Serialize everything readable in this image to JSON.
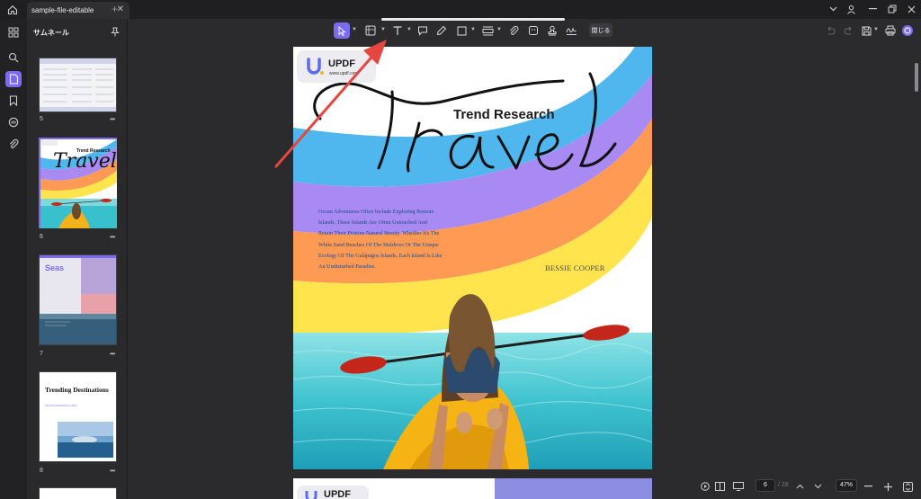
{
  "tab": {
    "title": "sample-file-editable",
    "close": "✕",
    "new": "+"
  },
  "sidebar": {
    "title": "サムネール",
    "thumbnails": [
      {
        "number": "5"
      },
      {
        "number": "6"
      },
      {
        "number": "7"
      },
      {
        "number": "8"
      }
    ],
    "more": "•••"
  },
  "thumb_texts": {
    "p6_title": "Travel",
    "p6_sub": "Trend Research",
    "p7_title": "Seas",
    "p8_title": "Trending Destinations",
    "p8_sub": "Top Travel Destinations of 2024"
  },
  "toolbar": {
    "close_label": "閉じる"
  },
  "page": {
    "logo": "UPDF",
    "logo_url": "www.updf.com",
    "title": "Travel",
    "subtitle": "Trend Research",
    "body_lines": [
      "Ocean Adventures Often Include Exploring Remote",
      "Islands. These Islands Are Often Untouched And",
      "Retain Their Pristine Natural Beauty. Whether It's The",
      "White Sand Beaches Of The Maldives Or The Unique",
      "Ecology Of The Galápagos Islands, Each Island Is Like",
      "An Undisturbed Paradise."
    ],
    "author": "BESSIE COOPER"
  },
  "page2": {
    "logo": "UPDF"
  },
  "status": {
    "current_page": "6",
    "total_pages": "/ 28",
    "zoom": "47%"
  },
  "colors": {
    "accent": "#7a6bf0",
    "rainbow": [
      "#4fb6ee",
      "#a98af3",
      "#ff9a55",
      "#ffe44d"
    ]
  }
}
